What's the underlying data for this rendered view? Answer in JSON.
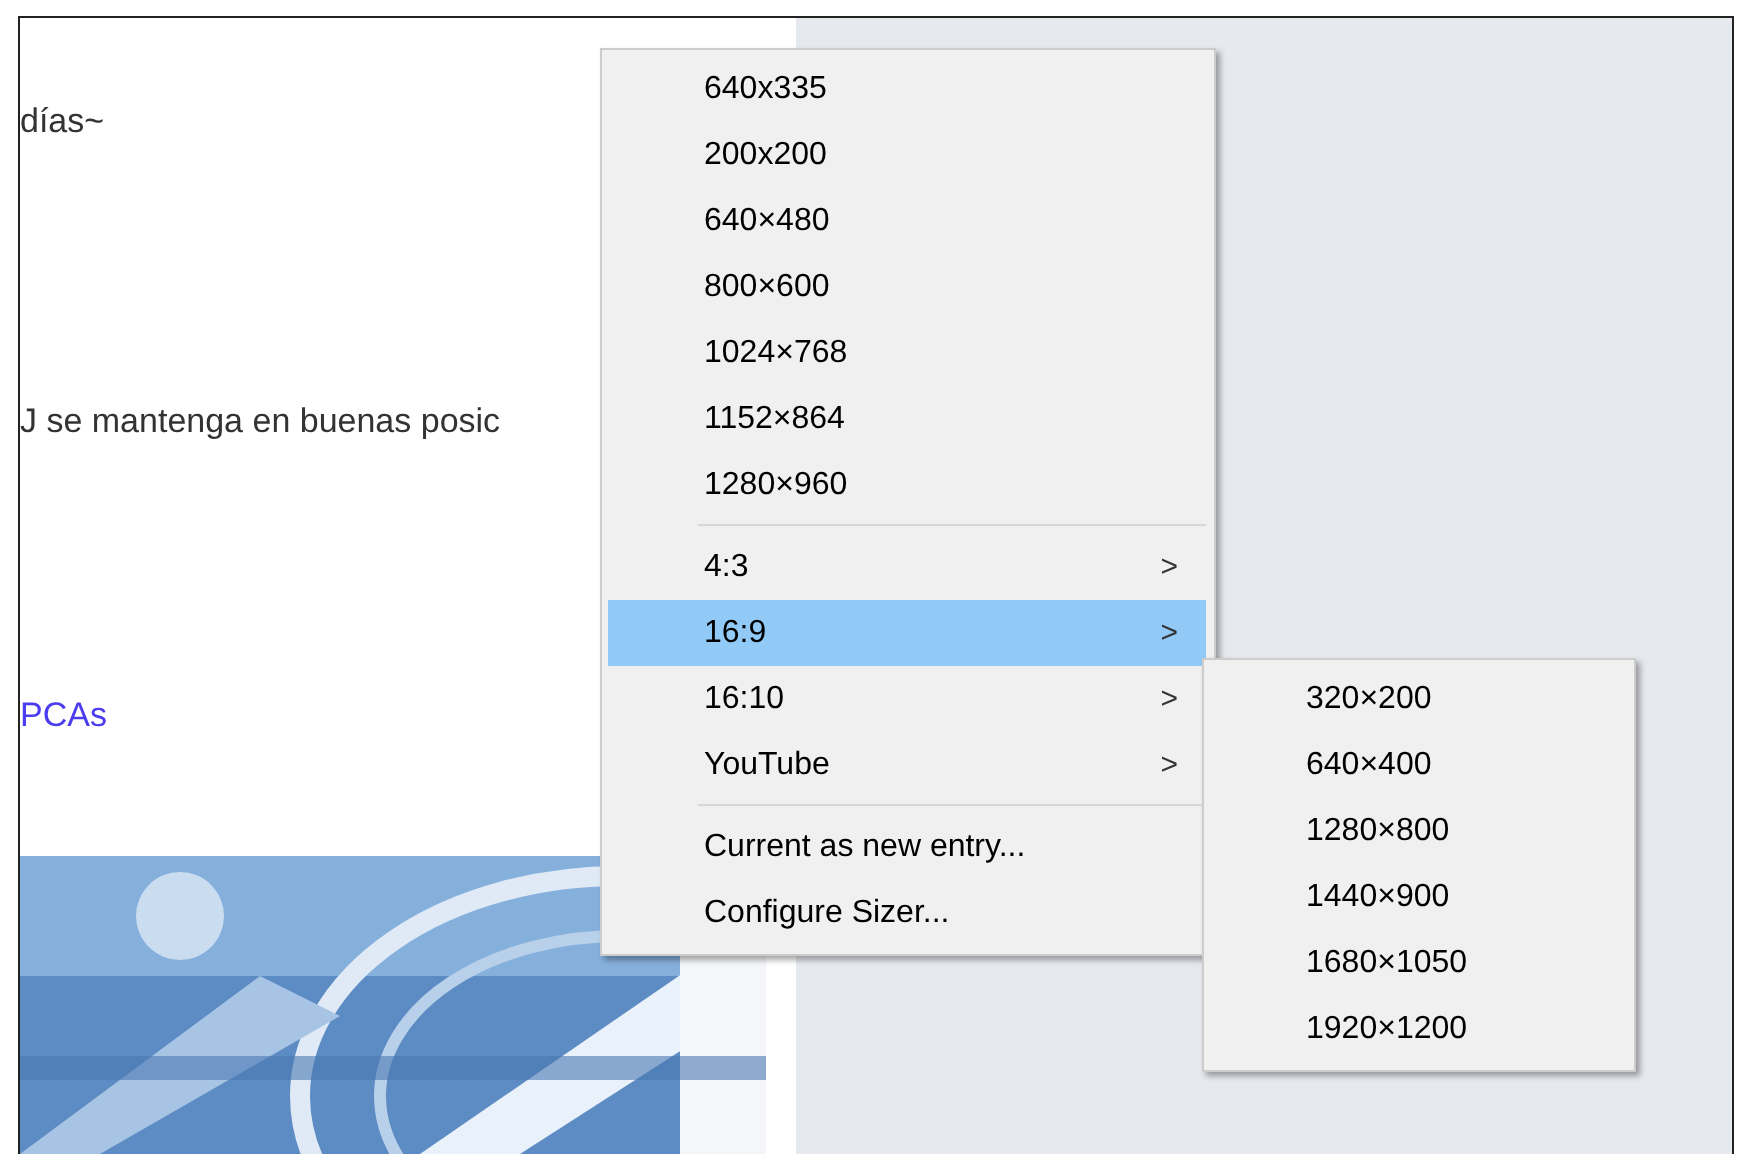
{
  "page": {
    "lines": [
      {
        "kind": "text",
        "text": "días~"
      },
      {
        "kind": "text",
        "text": "J se mantenga en buenas posic"
      },
      {
        "kind": "link",
        "text": "PCAs"
      }
    ]
  },
  "menu": {
    "items": [
      {
        "kind": "item",
        "label": "640x335",
        "selected": false
      },
      {
        "kind": "item",
        "label": "200x200",
        "selected": false
      },
      {
        "kind": "item",
        "label": "640×480",
        "selected": false
      },
      {
        "kind": "item",
        "label": "800×600",
        "selected": false
      },
      {
        "kind": "item",
        "label": "1024×768",
        "selected": false
      },
      {
        "kind": "item",
        "label": "1152×864",
        "selected": false
      },
      {
        "kind": "item",
        "label": "1280×960",
        "selected": false
      },
      {
        "kind": "separator"
      },
      {
        "kind": "submenu",
        "label": "4:3",
        "arrow": ">",
        "selected": false
      },
      {
        "kind": "submenu",
        "label": "16:9",
        "arrow": ">",
        "selected": true
      },
      {
        "kind": "submenu",
        "label": "16:10",
        "arrow": ">",
        "selected": false
      },
      {
        "kind": "submenu",
        "label": "YouTube",
        "arrow": ">",
        "selected": false
      },
      {
        "kind": "separator"
      },
      {
        "kind": "item",
        "label": "Current as new entry...",
        "selected": false
      },
      {
        "kind": "item",
        "label": "Configure Sizer...",
        "selected": false
      }
    ]
  },
  "submenu": {
    "items": [
      {
        "kind": "item",
        "label": "320×200",
        "selected": false
      },
      {
        "kind": "item",
        "label": "640×400",
        "selected": false
      },
      {
        "kind": "item",
        "label": "1280×800",
        "selected": false
      },
      {
        "kind": "item",
        "label": "1440×900",
        "selected": false
      },
      {
        "kind": "item",
        "label": "1680×1050",
        "selected": false
      },
      {
        "kind": "item",
        "label": "1920×1200",
        "selected": false
      }
    ]
  }
}
